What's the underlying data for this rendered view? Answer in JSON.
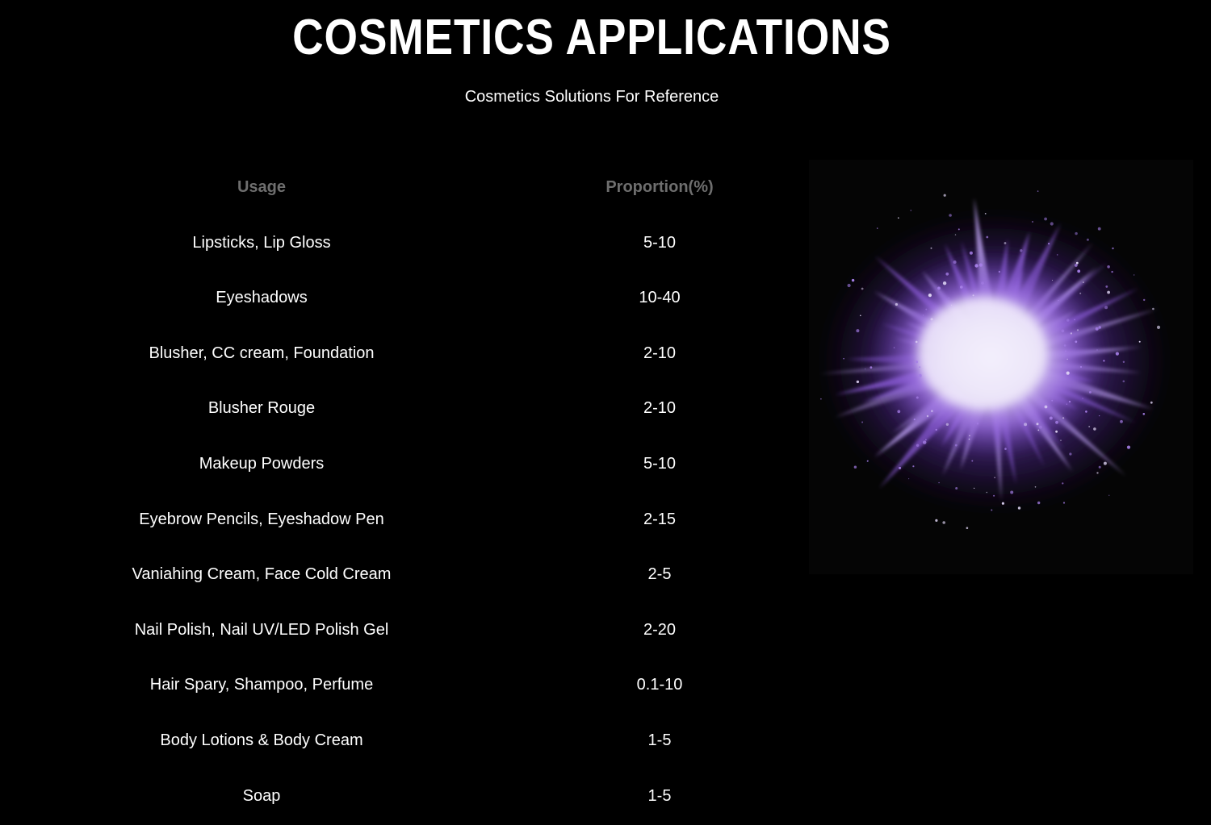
{
  "title": "COSMETICS APPLICATIONS",
  "subtitle": "Cosmetics Solutions For Reference",
  "table": {
    "headers": {
      "usage": "Usage",
      "proportion": "Proportion(%)"
    },
    "rows": [
      {
        "usage": "Lipsticks, Lip Gloss",
        "proportion": "5-10"
      },
      {
        "usage": "Eyeshadows",
        "proportion": "10-40"
      },
      {
        "usage": "Blusher, CC cream, Foundation",
        "proportion": "2-10"
      },
      {
        "usage": "Blusher Rouge",
        "proportion": "2-10"
      },
      {
        "usage": "Makeup Powders",
        "proportion": "5-10"
      },
      {
        "usage": "Eyebrow Pencils, Eyeshadow Pen",
        "proportion": "2-15"
      },
      {
        "usage": "Vaniahing Cream, Face Cold Cream",
        "proportion": "2-5"
      },
      {
        "usage": "Nail Polish, Nail UV/LED Polish Gel",
        "proportion": "2-20"
      },
      {
        "usage": "Hair Spary, Shampoo, Perfume",
        "proportion": "0.1-10"
      },
      {
        "usage": "Body Lotions & Body Cream",
        "proportion": "1-5"
      },
      {
        "usage": "Soap",
        "proportion": "1-5"
      }
    ]
  },
  "colors": {
    "background": "#000000",
    "text": "#ffffff",
    "header_text": "#6e6e6e",
    "powder_purple": "#8a5cd6",
    "powder_light": "#e4dcf5"
  }
}
